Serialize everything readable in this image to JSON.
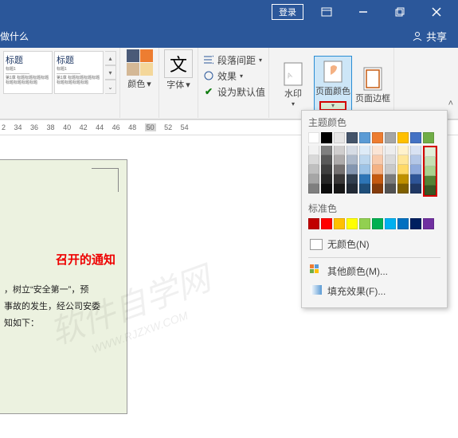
{
  "titlebar": {
    "login": "登录"
  },
  "share": {
    "label": "共享"
  },
  "tell_me": "做什么",
  "styles": {
    "item1": {
      "title": "标题",
      "body": "标题 1"
    },
    "item2": {
      "title": "标题",
      "body": "副标题文本…"
    }
  },
  "ribbon": {
    "colors_label": "颜色",
    "fonts_label": "字体",
    "font_char": "文",
    "para_spacing": "段落间距",
    "effects": "效果",
    "set_default": "设为默认值",
    "watermark": "水印",
    "page_color": "页面颜色",
    "page_border": "页面边框"
  },
  "ruler": {
    "marks": [
      "2",
      "34",
      "36",
      "38",
      "40",
      "42",
      "44",
      "46",
      "48",
      "50",
      "52",
      "54"
    ]
  },
  "page": {
    "title": "召开的通知",
    "line1": "，树立“安全第一”，预",
    "line2": "事故的发生，经公司安委",
    "line3": "知如下："
  },
  "watermark": {
    "big": "软件自学网",
    "small": "WWW.RJZXW.COM"
  },
  "dropdown": {
    "theme_title": "主题颜色",
    "standard_title": "标准色",
    "no_color": "无颜色(N)",
    "more_colors": "其他颜色(M)...",
    "fill_effects": "填充效果(F)...",
    "theme_base": [
      "#ffffff",
      "#000000",
      "#e7e6e6",
      "#44546a",
      "#5b9bd5",
      "#ed7d31",
      "#a5a5a5",
      "#ffc000",
      "#4472c4",
      "#70ad47"
    ],
    "theme_shades": [
      [
        "#f2f2f2",
        "#7f7f7f",
        "#d0cece",
        "#d6dce5",
        "#deebf7",
        "#fbe5d6",
        "#ededed",
        "#fff2cc",
        "#d9e2f3",
        "#e2efda"
      ],
      [
        "#d9d9d9",
        "#595959",
        "#aeabab",
        "#adb9ca",
        "#bdd7ee",
        "#f8cbad",
        "#dbdbdb",
        "#ffe699",
        "#b4c7e7",
        "#c5e0b4"
      ],
      [
        "#bfbfbf",
        "#3f3f3f",
        "#757171",
        "#8496b0",
        "#9dc3e6",
        "#f4b183",
        "#c9c9c9",
        "#ffd966",
        "#8faadc",
        "#a9d18e"
      ],
      [
        "#a6a6a6",
        "#262626",
        "#3a3838",
        "#323f4f",
        "#2e75b6",
        "#c55a11",
        "#7b7b7b",
        "#bf9000",
        "#2f5597",
        "#548235"
      ],
      [
        "#7f7f7f",
        "#0c0c0c",
        "#171717",
        "#222a35",
        "#1f4e79",
        "#843c0c",
        "#525252",
        "#7f6000",
        "#203864",
        "#385723"
      ]
    ],
    "standard": [
      "#c00000",
      "#ff0000",
      "#ffc000",
      "#ffff00",
      "#92d050",
      "#00b050",
      "#00b0f0",
      "#0070c0",
      "#002060",
      "#7030a0"
    ]
  }
}
